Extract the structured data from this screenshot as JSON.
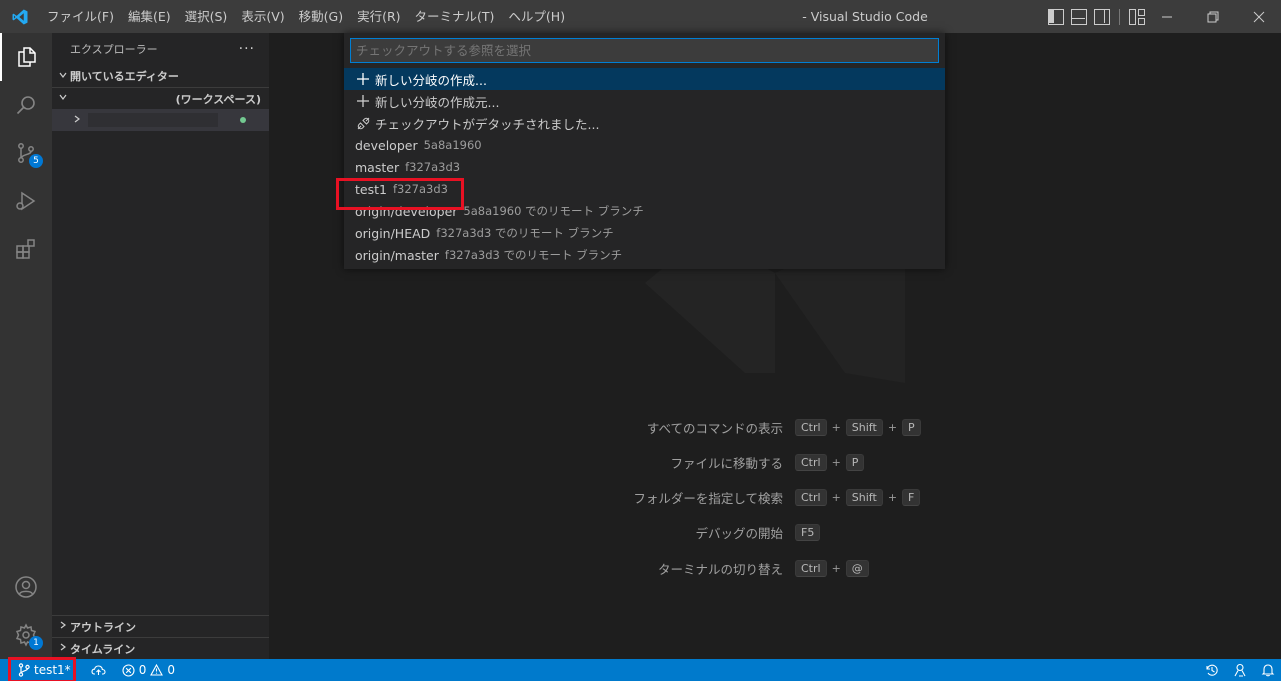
{
  "titlebar": {
    "menu": [
      "ファイル(F)",
      "編集(E)",
      "選択(S)",
      "表示(V)",
      "移動(G)",
      "実行(R)",
      "ターミナル(T)",
      "ヘルプ(H)"
    ],
    "window_title": "- Visual Studio Code"
  },
  "activitybar": {
    "scm_badge": "5",
    "settings_badge": "1"
  },
  "sidebar": {
    "title": "エクスプローラー",
    "more": "···",
    "open_editors": "開いているエディター",
    "workspace": "(ワークスペース)",
    "outline": "アウトライン",
    "timeline": "タイムライン"
  },
  "quickpick": {
    "placeholder": "チェックアウトする参照を選択",
    "items": [
      {
        "icon": "plus-icon",
        "label": "新しい分岐の作成...",
        "desc": ""
      },
      {
        "icon": "plus-icon",
        "label": "新しい分岐の作成元...",
        "desc": ""
      },
      {
        "icon": "debug-disconnect-icon",
        "label": "チェックアウトがデタッチされました...",
        "desc": ""
      },
      {
        "icon": "",
        "label": "developer",
        "desc": "5a8a1960"
      },
      {
        "icon": "",
        "label": "master",
        "desc": "f327a3d3"
      },
      {
        "icon": "",
        "label": "test1",
        "desc": "f327a3d3"
      },
      {
        "icon": "",
        "label": "origin/developer",
        "desc": "5a8a1960 でのリモート ブランチ"
      },
      {
        "icon": "",
        "label": "origin/HEAD",
        "desc": "f327a3d3 でのリモート ブランチ"
      },
      {
        "icon": "",
        "label": "origin/master",
        "desc": "f327a3d3 でのリモート ブランチ"
      }
    ]
  },
  "shortcuts": [
    {
      "label": "すべてのコマンドの表示",
      "keys": [
        "Ctrl",
        "Shift",
        "P"
      ]
    },
    {
      "label": "ファイルに移動する",
      "keys": [
        "Ctrl",
        "P"
      ]
    },
    {
      "label": "フォルダーを指定して検索",
      "keys": [
        "Ctrl",
        "Shift",
        "F"
      ]
    },
    {
      "label": "デバッグの開始",
      "keys": [
        "F5"
      ]
    },
    {
      "label": "ターミナルの切り替え",
      "keys": [
        "Ctrl",
        "@"
      ]
    }
  ],
  "statusbar": {
    "branch": "test1*",
    "errors": "0",
    "warnings": "0"
  },
  "colors": {
    "statusbar": "#007acc",
    "accent": "#0078d4",
    "highlight": "#e81123"
  }
}
